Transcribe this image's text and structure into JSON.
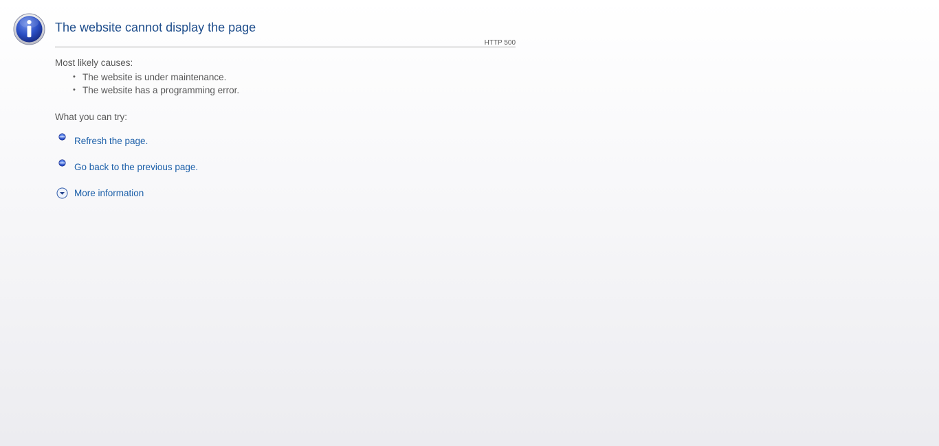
{
  "icon": "info-icon",
  "title": "The website cannot display the page",
  "http_code": "HTTP 500",
  "causes": {
    "label": "Most likely causes:",
    "items": [
      "The website is under maintenance.",
      "The website has a programming error."
    ]
  },
  "try": {
    "label": "What you can try:",
    "actions": [
      {
        "label": "Refresh the page.",
        "icon": "blue-bullet-icon"
      },
      {
        "label": "Go back to the previous page.",
        "icon": "blue-bullet-icon"
      },
      {
        "label": "More information",
        "icon": "chevron-down-circle-icon"
      }
    ]
  },
  "colors": {
    "title": "#1f4e8c",
    "link": "#1a5ea8",
    "text": "#575757",
    "rule": "#a6a6a6"
  }
}
